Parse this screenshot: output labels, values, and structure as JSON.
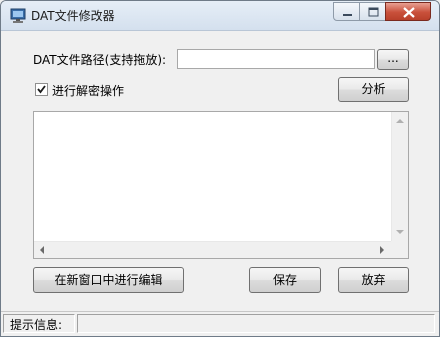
{
  "window": {
    "title": "DAT文件修改器"
  },
  "path_row": {
    "label": "DAT文件路径(支持拖放):",
    "value": "",
    "browse_label": "..."
  },
  "decrypt": {
    "label": "进行解密操作",
    "checked": true
  },
  "analyze_label": "分析",
  "editor": {
    "content": ""
  },
  "buttons": {
    "edit_in_new_window": "在新窗口中进行编辑",
    "save": "保存",
    "discard": "放弃"
  },
  "status": {
    "label": "提示信息:",
    "message": ""
  },
  "icons": {
    "app": "monitor-icon",
    "minimize": "minimize-icon",
    "maximize": "maximize-icon",
    "close": "close-icon",
    "check": "checkmark-icon"
  }
}
